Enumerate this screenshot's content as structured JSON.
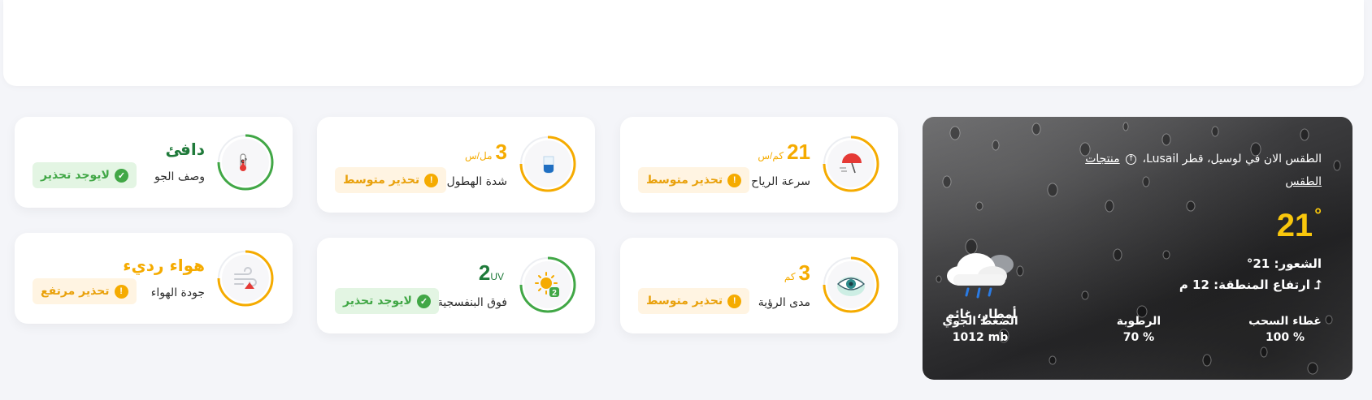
{
  "weather": {
    "location": "الطقس الان في لوسيل، قطر",
    "place": "Lusail،",
    "source": "منتجات",
    "source_line2": "الطقس",
    "temperature": "21",
    "degree": "°",
    "feels_like": "الشعور: 21°",
    "elevation": "ارتفاع المنطقة: 12 م",
    "condition": "أمطار، غائم",
    "stats": [
      {
        "label": "غطاء السحب",
        "value": "100 %"
      },
      {
        "label": "الرطوبة",
        "value": "70 %"
      },
      {
        "label": "الضغط الجوي",
        "value": "1012 mb"
      }
    ]
  },
  "cards": [
    {
      "id": "wind",
      "value": "21",
      "unit": "كم/س",
      "label": "سرعة الرياح",
      "badge": "تحذير متوسط",
      "badge_type": "warn",
      "icon": "umbrella-wind-icon",
      "ring_color": "#f5ab00",
      "value_color": "#f5ab00"
    },
    {
      "id": "visibility",
      "value": "3",
      "unit": "كم",
      "label": "مدى الرؤية",
      "badge": "تحذير متوسط",
      "badge_type": "warn",
      "icon": "eye-icon",
      "ring_color": "#f5ab00",
      "value_color": "#f5ab00"
    },
    {
      "id": "precip",
      "value": "3",
      "unit": "مل/س",
      "label": "شدة الهطول",
      "badge": "تحذير متوسط",
      "badge_type": "warn",
      "icon": "water-drop-icon",
      "ring_color": "#f5ab00",
      "value_color": "#f5ab00"
    },
    {
      "id": "uv",
      "value": "2",
      "unit": "UV",
      "label": "فوق البنفسجية",
      "badge": "لايوجد تحذير",
      "badge_type": "ok",
      "icon": "sun-uv-icon",
      "ring_color": "#41a746",
      "value_color": "#1f7a3a"
    },
    {
      "id": "desc",
      "word": "دافئ",
      "label": "وصف الجو",
      "badge": "لايوجد تحذير",
      "badge_type": "ok",
      "icon": "thermometer-icon",
      "ring_color": "#41a746",
      "value_color": "#1f7a3a"
    },
    {
      "id": "air",
      "word": "هواء رديء",
      "label": "جودة الهواء",
      "badge": "تحذير مرتفع",
      "badge_type": "warn",
      "icon": "air-quality-icon",
      "ring_color": "#f5ab00",
      "value_color": "#f5ab00"
    }
  ]
}
